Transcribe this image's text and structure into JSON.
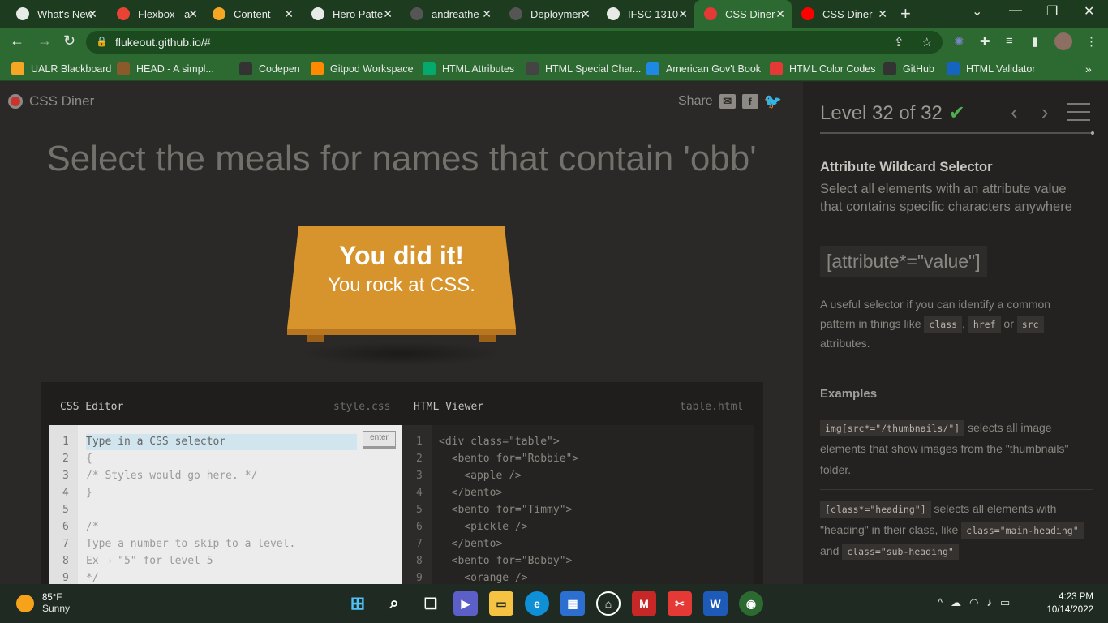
{
  "browser": {
    "tabs": [
      {
        "title": "What's New",
        "icon": "github-icon",
        "color": "#e8eae8"
      },
      {
        "title": "Flexbox - a",
        "icon": "gmail-icon",
        "color": "#ea4335"
      },
      {
        "title": "Content",
        "icon": "pencil-icon",
        "color": "#f5a623"
      },
      {
        "title": "Hero Patte",
        "icon": "globe-icon",
        "color": "#e8eae8"
      },
      {
        "title": "andreathe",
        "icon": "github-icon",
        "color": "#555"
      },
      {
        "title": "Deploymen",
        "icon": "github-icon",
        "color": "#555"
      },
      {
        "title": "IFSC 1310",
        "icon": "globe-icon",
        "color": "#e8eae8"
      },
      {
        "title": "CSS Diner",
        "icon": "css-diner-icon",
        "color": "#e53935",
        "active": true
      },
      {
        "title": "CSS Diner",
        "icon": "youtube-icon",
        "color": "#ff0000"
      }
    ],
    "url": "flukeout.github.io/#",
    "bookmarks": [
      {
        "label": "UALR Blackboard",
        "icon": "blackboard-icon",
        "color": "#f5a623"
      },
      {
        "label": "HEAD - A simpl...",
        "icon": "emoji-icon",
        "color": "#8b5a2b"
      },
      {
        "label": "Codepen",
        "icon": "codepen-icon",
        "color": "#333"
      },
      {
        "label": "Gitpod Workspace",
        "icon": "gitpod-icon",
        "color": "#ff8a00"
      },
      {
        "label": "HTML Attributes",
        "icon": "w3schools-icon",
        "color": "#04aa6d"
      },
      {
        "label": "HTML Special Char...",
        "icon": "chars-icon",
        "color": "#444"
      },
      {
        "label": "American Gov't Book",
        "icon": "pressbooks-icon",
        "color": "#1e88e5"
      },
      {
        "label": "HTML Color Codes",
        "icon": "color-icon",
        "color": "#e53935"
      },
      {
        "label": "GitHub",
        "icon": "github-icon",
        "color": "#333"
      },
      {
        "label": "HTML Validator",
        "icon": "w3c-icon",
        "color": "#1565c0"
      }
    ]
  },
  "app": {
    "logo_text": "CSS Diner",
    "share_label": "Share",
    "instruction": "Select the meals for names that contain 'obb'",
    "table_message_1": "You did it!",
    "table_message_2": "You rock at CSS.",
    "css_editor": {
      "title": "CSS Editor",
      "file": "style.css",
      "placeholder": "Type in a CSS selector",
      "enter_label": "enter",
      "lines": [
        "{",
        "/* Styles would go here. */",
        "}",
        "",
        "/*",
        "Type a number to skip to a level.",
        "Ex → \"5\" for level 5",
        "*/"
      ],
      "line_numbers": [
        "1",
        "2",
        "3",
        "4",
        "5",
        "6",
        "7",
        "8",
        "9"
      ]
    },
    "html_viewer": {
      "title": "HTML Viewer",
      "file": "table.html",
      "lines": [
        "<div class=\"table\">",
        "  <bento for=\"Robbie\">",
        "    <apple />",
        "  </bento>",
        "  <bento for=\"Timmy\">",
        "    <pickle />",
        "  </bento>",
        "  <bento for=\"Bobby\">",
        "    <orange />"
      ],
      "line_numbers": [
        "1",
        "2",
        "3",
        "4",
        "5",
        "6",
        "7",
        "8",
        "9"
      ]
    },
    "sidebar": {
      "level_text": "Level 32 of 32",
      "selector_title": "Attribute Wildcard Selector",
      "selector_desc": "Select all elements with an attribute value that contains specific characters anywhere",
      "syntax": "[attribute*=\"value\"]",
      "hint_1": "A useful selector if you can identify a common pattern in things like",
      "hint_code_1": "class",
      "hint_sep_1": ",",
      "hint_code_2": "href",
      "hint_or": "or",
      "hint_code_3": "src",
      "hint_2": "attributes.",
      "examples_heading": "Examples",
      "ex1_code": "img[src*=\"/thumbnails/\"]",
      "ex1_text": "selects all image elements that show images from the \"thumbnails\" folder.",
      "ex2_code": "[class*=\"heading\"]",
      "ex2_text_1": "selects all elements with \"heading\" in their class, like",
      "ex2_code_2": "class=\"main-heading\"",
      "ex2_and": "and",
      "ex2_code_3": "class=\"sub-heading\""
    }
  },
  "taskbar": {
    "temp": "85°F",
    "condition": "Sunny",
    "time": "4:23 PM",
    "date": "10/14/2022"
  }
}
